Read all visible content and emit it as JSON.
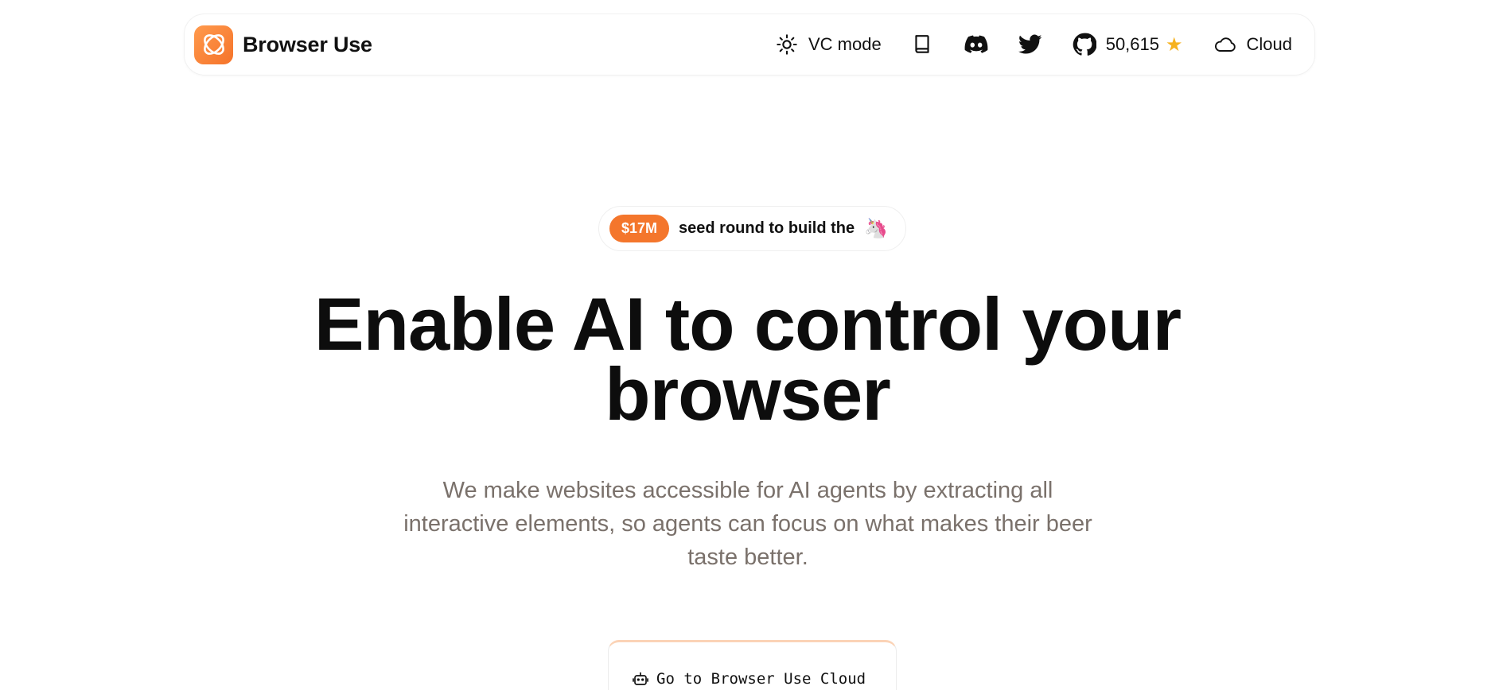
{
  "header": {
    "brand_name": "Browser Use",
    "vc_mode_label": "VC mode",
    "github_stars": "50,615",
    "cloud_label": "Cloud"
  },
  "badge": {
    "amount": "$17M",
    "text": "seed round to build the",
    "emoji": "🦄"
  },
  "hero": {
    "title_line1": "Enable AI to control your",
    "title_line2": "browser",
    "subtitle_line1": "We make websites accessible for AI agents by extracting all",
    "subtitle_line2": "interactive elements, so agents can focus on what makes their beer",
    "subtitle_line3": "taste better."
  },
  "cta": {
    "label": "Go to Browser Use Cloud"
  },
  "colors": {
    "accent": "#f4762c",
    "subtitle": "#7a716b"
  }
}
